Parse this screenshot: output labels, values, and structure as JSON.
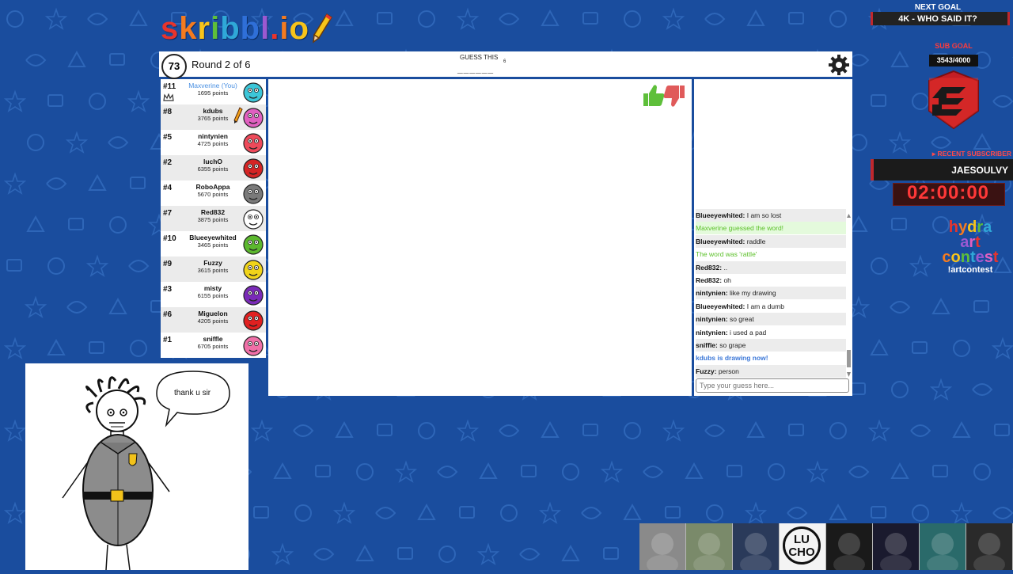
{
  "logo": {
    "letters": [
      "s",
      "k",
      "r",
      "i",
      "b",
      "b",
      "l",
      ".",
      "i",
      "o"
    ],
    "colors": [
      "#e8342c",
      "#f47b20",
      "#f7c41a",
      "#5ebf3a",
      "#2fa8d8",
      "#2f6fd8",
      "#9b59d1",
      "#e8342c",
      "#f47b20",
      "#f7c41a"
    ]
  },
  "header": {
    "timer": "73",
    "round": "Round 2 of 6",
    "guess_label": "GUESS THIS",
    "guess_count": "6",
    "guess_blanks": "______"
  },
  "players": [
    {
      "rank": "#11",
      "name": "Maxverine (You)",
      "points": "1695 points",
      "color": "#3cc6d8",
      "you": true,
      "crown": true
    },
    {
      "rank": "#8",
      "name": "kdubs",
      "points": "3765 points",
      "color": "#e060c0",
      "drawing": true
    },
    {
      "rank": "#5",
      "name": "nintynien",
      "points": "4725 points",
      "color": "#ee4a5a"
    },
    {
      "rank": "#2",
      "name": "luchO",
      "points": "6355 points",
      "color": "#d42424"
    },
    {
      "rank": "#4",
      "name": "RoboAppa",
      "points": "5670 points",
      "color": "#7a7a7a"
    },
    {
      "rank": "#7",
      "name": "Red832",
      "points": "3875 points",
      "color": "#ffffff"
    },
    {
      "rank": "#10",
      "name": "Blueeyewhited",
      "points": "3465 points",
      "color": "#5cb82e"
    },
    {
      "rank": "#9",
      "name": "Fuzzy",
      "points": "3615 points",
      "color": "#f0d41a"
    },
    {
      "rank": "#3",
      "name": "misty",
      "points": "6155 points",
      "color": "#7a2ab8"
    },
    {
      "rank": "#6",
      "name": "Miguelon",
      "points": "4205 points",
      "color": "#e02020"
    },
    {
      "rank": "#1",
      "name": "sniffle",
      "points": "6705 points",
      "color": "#f070a8"
    }
  ],
  "chat": {
    "messages": [
      {
        "user": "Blueeyewhited:",
        "text": " I am so lost"
      },
      {
        "text": "Maxverine guessed the word!",
        "kind": "green",
        "bg": true
      },
      {
        "user": "Blueeyewhited:",
        "text": " raddle"
      },
      {
        "text": "The word was 'rattle'",
        "kind": "green"
      },
      {
        "user": "Red832:",
        "text": " .."
      },
      {
        "user": "Red832:",
        "text": " oh"
      },
      {
        "user": "nintynien:",
        "text": " like my drawing"
      },
      {
        "user": "Blueeyewhited:",
        "text": " I am a dumb"
      },
      {
        "user": "nintynien:",
        "text": " so great"
      },
      {
        "user": "nintynien:",
        "text": " i used a pad"
      },
      {
        "user": "sniffle:",
        "text": " so grape"
      },
      {
        "text": "kdubs is drawing now!",
        "kind": "blue"
      },
      {
        "user": "Fuzzy:",
        "text": " person"
      }
    ],
    "input_placeholder": "Type your guess here..."
  },
  "webcam": {
    "bubble_text": "thank u sir"
  },
  "overlay": {
    "next_goal_label": "NEXT GOAL",
    "next_goal_value": "4K - WHO SAID IT?",
    "sub_goal_label": "SUB GOAL",
    "sub_goal_value": "3543/4000",
    "sub_goal_progress": 0.886,
    "recent_label": "▸ RECENT SUBSCRIBER",
    "recent_name": "JAESOULVY",
    "timer": "02:00:00",
    "hydra_words": [
      "hydra",
      "art",
      "contest"
    ],
    "hydra_colors": [
      "#e8342c",
      "#f47b20",
      "#f7c41a",
      "#5ebf3a",
      "#2fa8d8",
      "#9b59d1",
      "#e060c0"
    ],
    "artcontest_cmd": "!artcontest"
  },
  "emotes": [
    {
      "name": "cat-emote",
      "color": "#8a8a8a"
    },
    {
      "name": "helmet-emote",
      "color": "#7a8a6a"
    },
    {
      "name": "sailor-emote",
      "color": "#2a3a5a"
    },
    {
      "name": "lucho-emote",
      "color": "#f4f4f4",
      "text": "LU\nCHO"
    },
    {
      "name": "pattern-emote",
      "color": "#1a1a1a"
    },
    {
      "name": "shadow-emote",
      "color": "#1a1a2e"
    },
    {
      "name": "dragon-emote",
      "color": "#2a6a6a"
    },
    {
      "name": "cat2-emote",
      "color": "#2a2a2a"
    }
  ]
}
